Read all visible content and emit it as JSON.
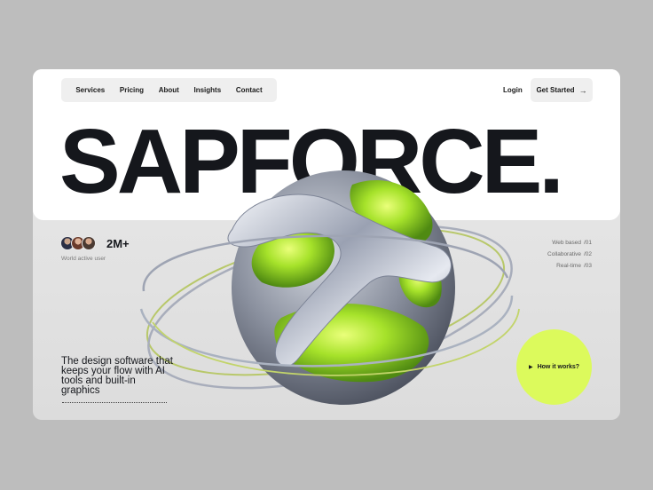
{
  "nav": {
    "items": [
      {
        "label": "Services"
      },
      {
        "label": "Pricing"
      },
      {
        "label": "About"
      },
      {
        "label": "Insights"
      },
      {
        "label": "Contact"
      }
    ],
    "login_label": "Login",
    "cta_label": "Get Started",
    "cta_icon": "arrow-right-icon"
  },
  "hero": {
    "brand": "SAPFORCE."
  },
  "users": {
    "count": "2M+",
    "label": "World active user"
  },
  "features": [
    {
      "label": "Web based",
      "num": "/01"
    },
    {
      "label": "Collaborative",
      "num": "/02"
    },
    {
      "label": "Real-time",
      "num": "/03"
    }
  ],
  "tagline": "The design software that keeps your flow with AI tools and built-in graphics",
  "how_it_works": {
    "label": "How it works?",
    "icon": "play-icon"
  },
  "colors": {
    "accent": "#dcfa5c",
    "text": "#15171c",
    "page_bg": "#bdbdbd"
  }
}
